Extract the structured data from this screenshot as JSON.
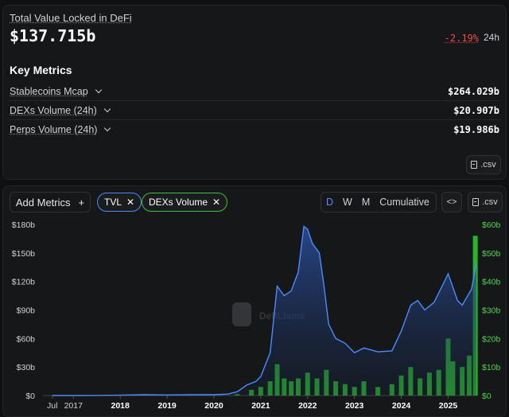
{
  "tvl": {
    "label": "Total Value Locked in DeFi",
    "value": "$137.715b",
    "change": "-2.19%",
    "period": "24h"
  },
  "key_metrics": {
    "title": "Key Metrics",
    "items": [
      {
        "label": "Stablecoins Mcap",
        "value": "$264.029b"
      },
      {
        "label": "DEXs Volume (24h)",
        "value": "$20.907b"
      },
      {
        "label": "Perps Volume (24h)",
        "value": "$19.986b"
      }
    ],
    "csv_label": ".csv"
  },
  "toolbar": {
    "add_metrics": "Add Metrics",
    "plus": "+",
    "pills": [
      {
        "label": "TVL",
        "color": "#4a8cff"
      },
      {
        "label": "DEXs Volume",
        "color": "#3cc23c"
      }
    ],
    "periods": [
      "D",
      "W",
      "M",
      "Cumulative"
    ],
    "active_period": "D",
    "embed_label": "<>",
    "csv_label": ".csv"
  },
  "watermark": "DefiLlama",
  "colors": {
    "tvl": "#4a8cff",
    "dex": "#2ec32e",
    "negative": "#f04a4a",
    "background": "#161718"
  },
  "chart_data": {
    "type": "area",
    "x_ticks": [
      "Jul",
      "2017",
      "2018",
      "2019",
      "2020",
      "2021",
      "2022",
      "2023",
      "2024",
      "2025"
    ],
    "left_axis": {
      "ticks": [
        "$0",
        "$30b",
        "$60b",
        "$90b",
        "$120b",
        "$150b",
        "$180b"
      ],
      "range": [
        0,
        180
      ]
    },
    "right_axis": {
      "ticks": [
        "$0",
        "$10b",
        "$20b",
        "$30b",
        "$40b",
        "$50b",
        "$60b"
      ],
      "range": [
        0,
        60
      ]
    },
    "series": [
      {
        "name": "TVL",
        "type": "area",
        "x": [
          2016.55,
          2017.0,
          2017.5,
          2018.0,
          2018.5,
          2019.0,
          2019.5,
          2020.0,
          2020.3,
          2020.5,
          2020.7,
          2020.9,
          2021.0,
          2021.2,
          2021.35,
          2021.5,
          2021.65,
          2021.8,
          2021.92,
          2022.0,
          2022.1,
          2022.25,
          2022.35,
          2022.45,
          2022.6,
          2022.8,
          2023.0,
          2023.2,
          2023.5,
          2023.8,
          2024.0,
          2024.2,
          2024.35,
          2024.5,
          2024.7,
          2024.9,
          2025.0,
          2025.2,
          2025.3,
          2025.5,
          2025.6
        ],
        "values": [
          0,
          0,
          0.1,
          0.3,
          0.8,
          0.6,
          0.8,
          0.8,
          1.5,
          4,
          11,
          15,
          20,
          45,
          115,
          105,
          110,
          130,
          178,
          175,
          160,
          150,
          115,
          75,
          60,
          55,
          45,
          50,
          46,
          47,
          68,
          95,
          100,
          90,
          98,
          118,
          128,
          100,
          95,
          112,
          138
        ]
      },
      {
        "name": "DEXs Volume",
        "type": "bar",
        "x": [
          2020.5,
          2020.8,
          2021.0,
          2021.2,
          2021.35,
          2021.5,
          2021.65,
          2021.8,
          2022.0,
          2022.2,
          2022.4,
          2022.6,
          2022.8,
          2023.0,
          2023.2,
          2023.5,
          2023.8,
          2024.0,
          2024.2,
          2024.4,
          2024.6,
          2024.8,
          2025.0,
          2025.1,
          2025.3,
          2025.45,
          2025.58
        ],
        "values": [
          0.5,
          2,
          3,
          5,
          11,
          6,
          5,
          6,
          8,
          6,
          9,
          5,
          4,
          3,
          5,
          3,
          4,
          7,
          10,
          6,
          8,
          9,
          20,
          12,
          10,
          14,
          56
        ]
      }
    ]
  }
}
